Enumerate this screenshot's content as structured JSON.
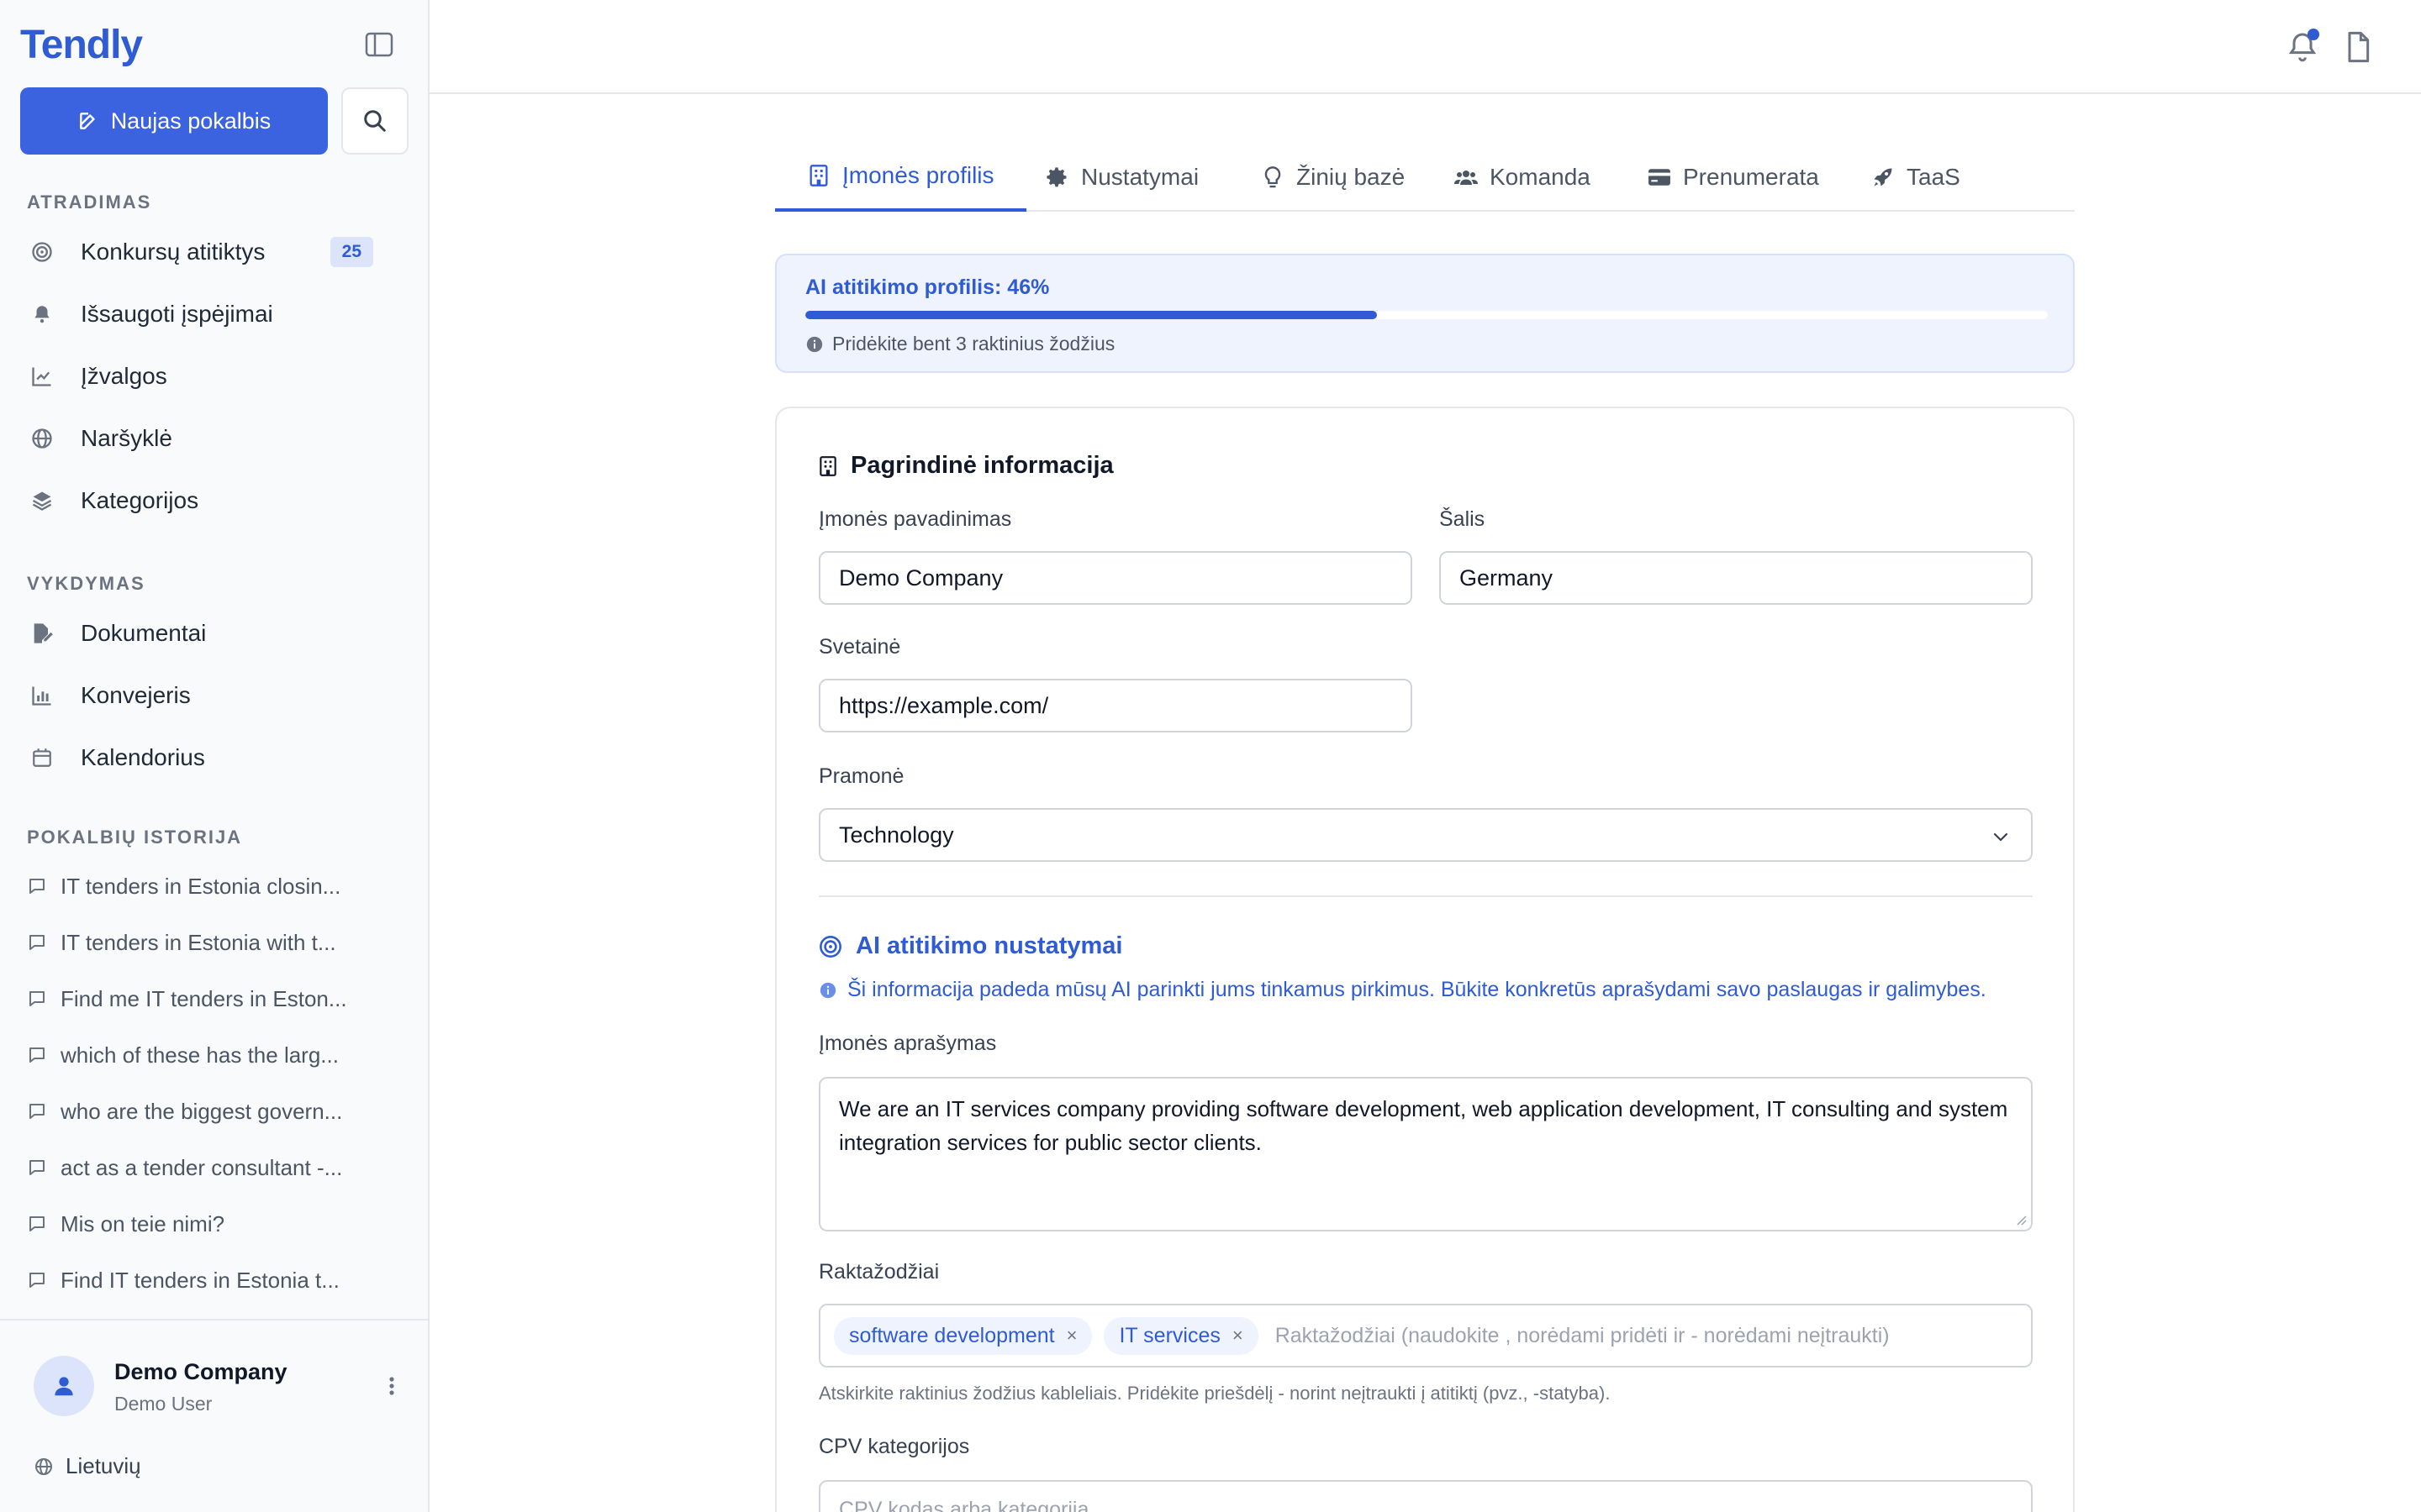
{
  "sidebar": {
    "brand": "Tendly",
    "new_chat_label": "Naujas pokalbis",
    "sections": {
      "discovery": "ATRADIMAS",
      "execution": "VYKDYMAS",
      "history": "POKALBIŲ ISTORIJA"
    },
    "discovery_items": [
      {
        "label": "Konkursų atitiktys",
        "icon": "target-icon",
        "badge": "25"
      },
      {
        "label": "Išsaugoti įspėjimai",
        "icon": "bell-icon"
      },
      {
        "label": "Įžvalgos",
        "icon": "chart-line-icon"
      },
      {
        "label": "Naršyklė",
        "icon": "globe-icon"
      },
      {
        "label": "Kategorijos",
        "icon": "layers-icon"
      }
    ],
    "execution_items": [
      {
        "label": "Dokumentai",
        "icon": "file-pen-icon"
      },
      {
        "label": "Konvejeris",
        "icon": "bar-chart-icon"
      },
      {
        "label": "Kalendorius",
        "icon": "calendar-icon"
      }
    ],
    "history_items": [
      "IT tenders in Estonia closin...",
      "IT tenders in Estonia with t...",
      "Find me IT tenders in Eston...",
      "which of these has the larg...",
      "who are the biggest govern...",
      "act as a tender consultant -...",
      "Mis on teie nimi?",
      "Find IT tenders in Estonia t..."
    ],
    "user": {
      "company": "Demo Company",
      "role": "Demo User"
    },
    "language": "Lietuvių"
  },
  "tabs": [
    {
      "label": "Įmonės profilis",
      "icon": "building-icon",
      "active": true
    },
    {
      "label": "Nustatymai",
      "icon": "gear-icon"
    },
    {
      "label": "Žinių bazė",
      "icon": "lightbulb-icon"
    },
    {
      "label": "Komanda",
      "icon": "users-icon"
    },
    {
      "label": "Prenumerata",
      "icon": "credit-card-icon"
    },
    {
      "label": "TaaS",
      "icon": "rocket-icon"
    }
  ],
  "progress": {
    "title": "AI atitikimo profilis: 46%",
    "value_percent": 46,
    "hint": "Pridėkite bent 3 raktinius žodžius"
  },
  "form": {
    "section_title": "Pagrindinė informacija",
    "company_name": {
      "label": "Įmonės pavadinimas",
      "value": "Demo Company"
    },
    "country": {
      "label": "Šalis",
      "value": "Germany"
    },
    "website": {
      "label": "Svetainė",
      "value": "https://example.com/"
    },
    "industry": {
      "label": "Pramonė",
      "value": "Technology"
    },
    "ai_section_title": "AI atitikimo nustatymai",
    "ai_hint": "Ši informacija padeda mūsų AI parinkti jums tinkamus pirkimus. Būkite konkretūs aprašydami savo paslaugas ir galimybes.",
    "description": {
      "label": "Įmonės aprašymas",
      "value": "We are an IT services company providing software development, web application development, IT consulting and system integration services for public sector clients."
    },
    "keywords": {
      "label": "Raktažodžiai",
      "chips": [
        "software development",
        "IT services"
      ],
      "placeholder": "Raktažodžiai (naudokite , norėdami pridėti ir - norėdami neįtraukti)",
      "help": "Atskirkite raktinius žodžius kableliais. Pridėkite priešdėlį - norint neįtraukti į atitiktį (pvz., -statyba)."
    },
    "cpv": {
      "label": "CPV kategorijos",
      "placeholder": "CPV kodas arba kategorija"
    }
  },
  "colors": {
    "accent": "#2f5bd3",
    "button": "#3b63e0",
    "border": "#e5e7eb"
  }
}
